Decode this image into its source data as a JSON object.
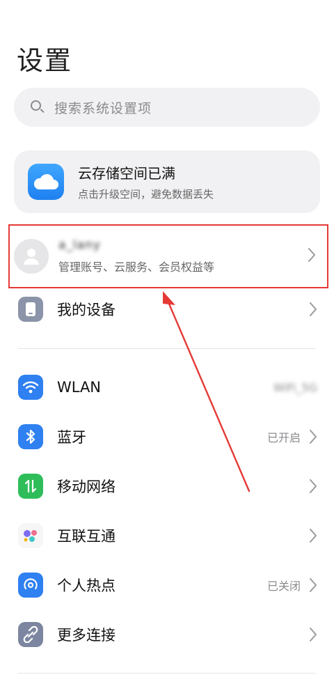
{
  "page": {
    "title": "设置"
  },
  "search": {
    "placeholder": "搜索系统设置项"
  },
  "cloud_banner": {
    "title": "云存储空间已满",
    "subtitle": "点击升级空间，避免数据丢失"
  },
  "account": {
    "name": "a_lany",
    "subtitle": "管理账号、云服务、会员权益等"
  },
  "items": [
    {
      "label": "我的设备",
      "status": "",
      "icon": "device-icon",
      "color": "#8b94a8"
    },
    {
      "label": "WLAN",
      "status": "WiFi_5G",
      "icon": "wifi-icon",
      "color": "#2f80f0"
    },
    {
      "label": "蓝牙",
      "status": "已开启",
      "icon": "bluetooth-icon",
      "color": "#2f80f0"
    },
    {
      "label": "移动网络",
      "status": "",
      "icon": "mobile-network-icon",
      "color": "#2fbd5a"
    },
    {
      "label": "互联互通",
      "status": "",
      "icon": "interconnect-icon",
      "color": "#f6f6f6"
    },
    {
      "label": "个人热点",
      "status": "已关闭",
      "icon": "hotspot-icon",
      "color": "#2f80f0"
    },
    {
      "label": "更多连接",
      "status": "",
      "icon": "more-connections-icon",
      "color": "#7d86a0"
    }
  ],
  "colors": {
    "highlight_box": "#e53935",
    "arrow": "#e53935"
  }
}
